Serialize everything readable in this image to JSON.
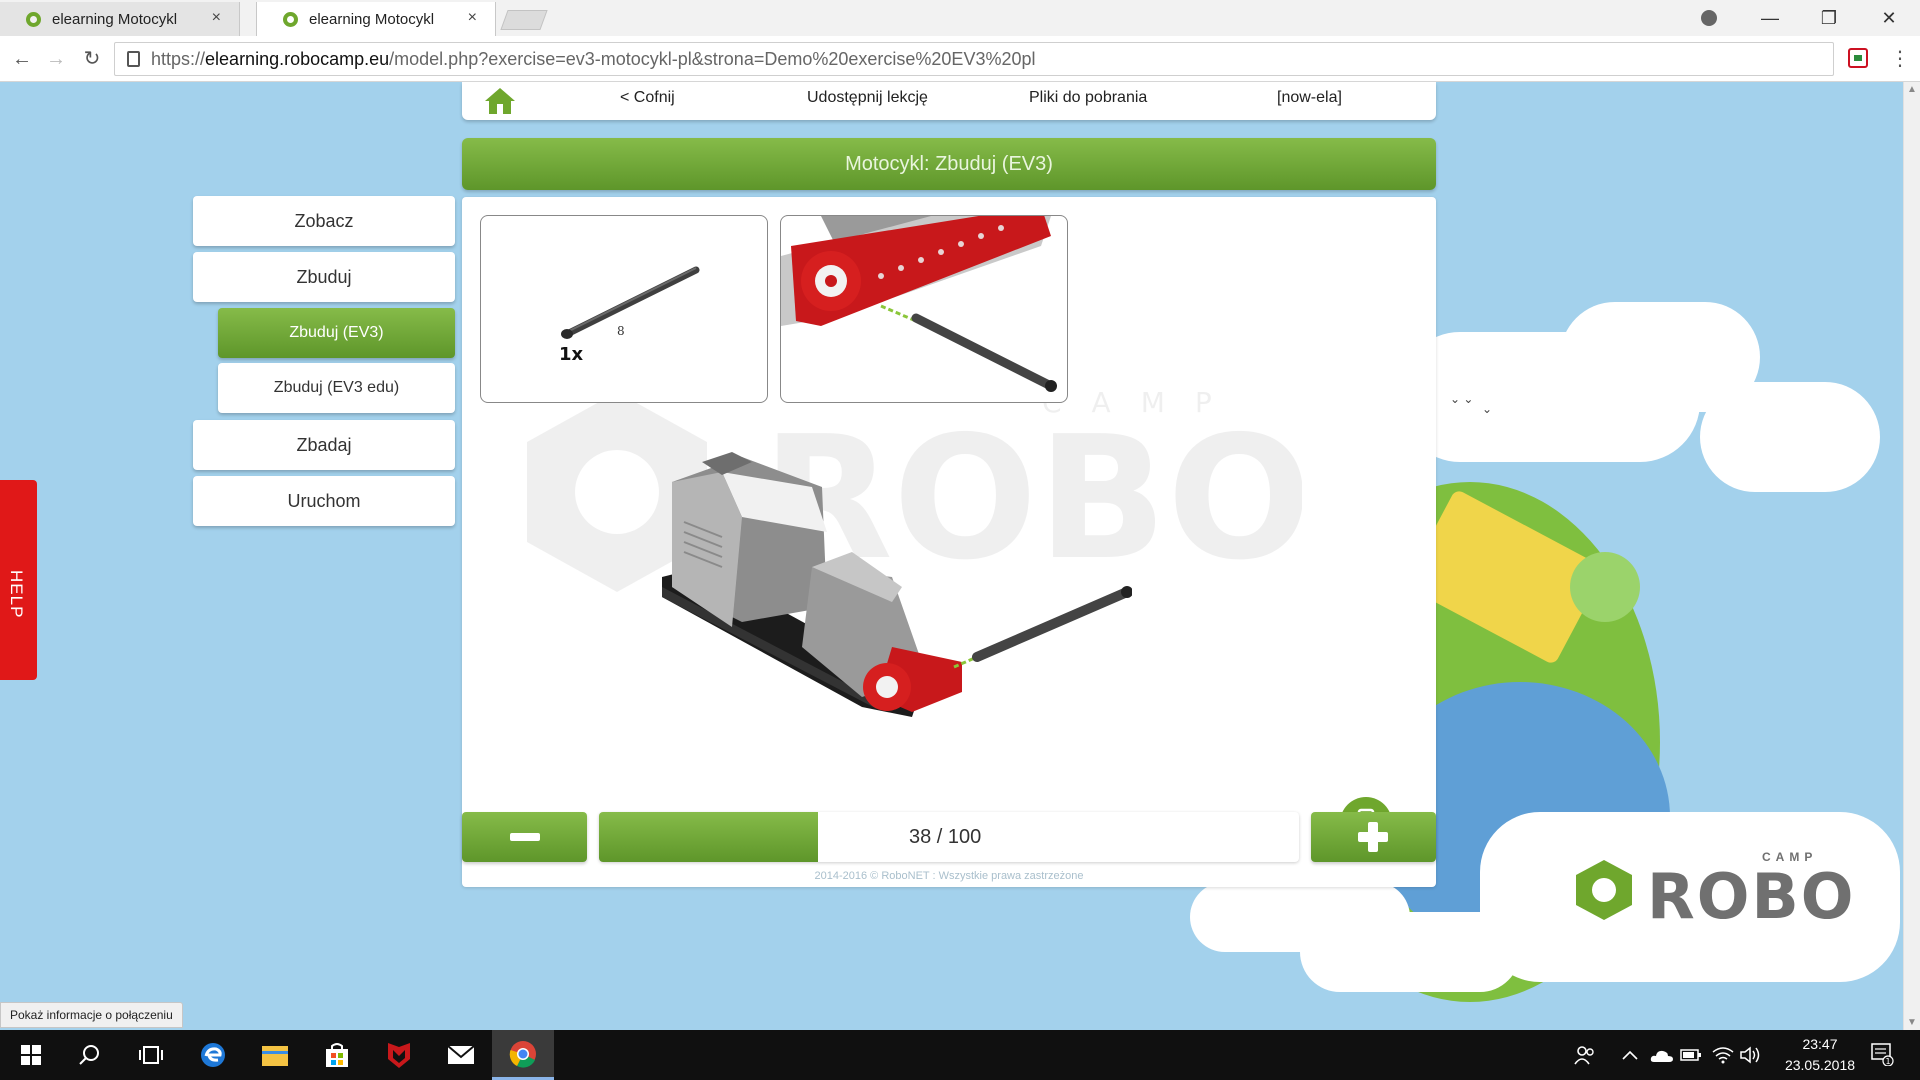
{
  "browser": {
    "tabs": [
      {
        "title": "elearning Motocykl",
        "close": "×"
      },
      {
        "title": "elearning Motocykl",
        "close": "×"
      }
    ],
    "url": {
      "scheme": "https://",
      "host": "elearning.robocamp.eu",
      "rest": "/model.php?exercise=ev3-motocykl-pl&strona=Demo%20exercise%20EV3%20pl"
    },
    "window_controls": {
      "minimize": "—",
      "restore": "❐",
      "close": "✕"
    },
    "nav": {
      "back": "←",
      "forward": "→",
      "reload": "↻",
      "menu": "⋮"
    },
    "status_text": "Pokaż informacje o połączeniu"
  },
  "site_nav": {
    "back": "< Cofnij",
    "share": "Udostępnij lekcję",
    "files": "Pliki do pobrania",
    "user": "[now-ela]"
  },
  "header": {
    "title": "Motocykl: Zbuduj (EV3)"
  },
  "side_menu": {
    "items": [
      {
        "label": "Zobacz",
        "active": false
      },
      {
        "label": "Zbuduj",
        "active": false
      },
      {
        "label": "Zbuduj (EV3)",
        "active": true
      },
      {
        "label": "Zbuduj (EV3 edu)",
        "active": false
      },
      {
        "label": "Zbadaj",
        "active": false
      },
      {
        "label": "Uruchom",
        "active": false
      }
    ]
  },
  "help": {
    "label": "HELP"
  },
  "instruction": {
    "part_quantity": "1x",
    "part_length": "8",
    "watermark_text": "ROBO",
    "watermark_sub": "CAMP"
  },
  "progress": {
    "current": 38,
    "total": 100,
    "text": "38 / 100",
    "fill_percent": 31.3
  },
  "footer": {
    "copyright": "2014-2016 © RoboNET : Wszystkie prawa zastrzeżone"
  },
  "logo": {
    "brand": "ROBO",
    "sub": "CAMP"
  },
  "taskbar": {
    "time": "23:47",
    "date": "23.05.2018",
    "notifications": "1"
  },
  "colors": {
    "accent_green": "#6fa72d",
    "help_red": "#e01818",
    "sky": "#a3d1ec"
  }
}
